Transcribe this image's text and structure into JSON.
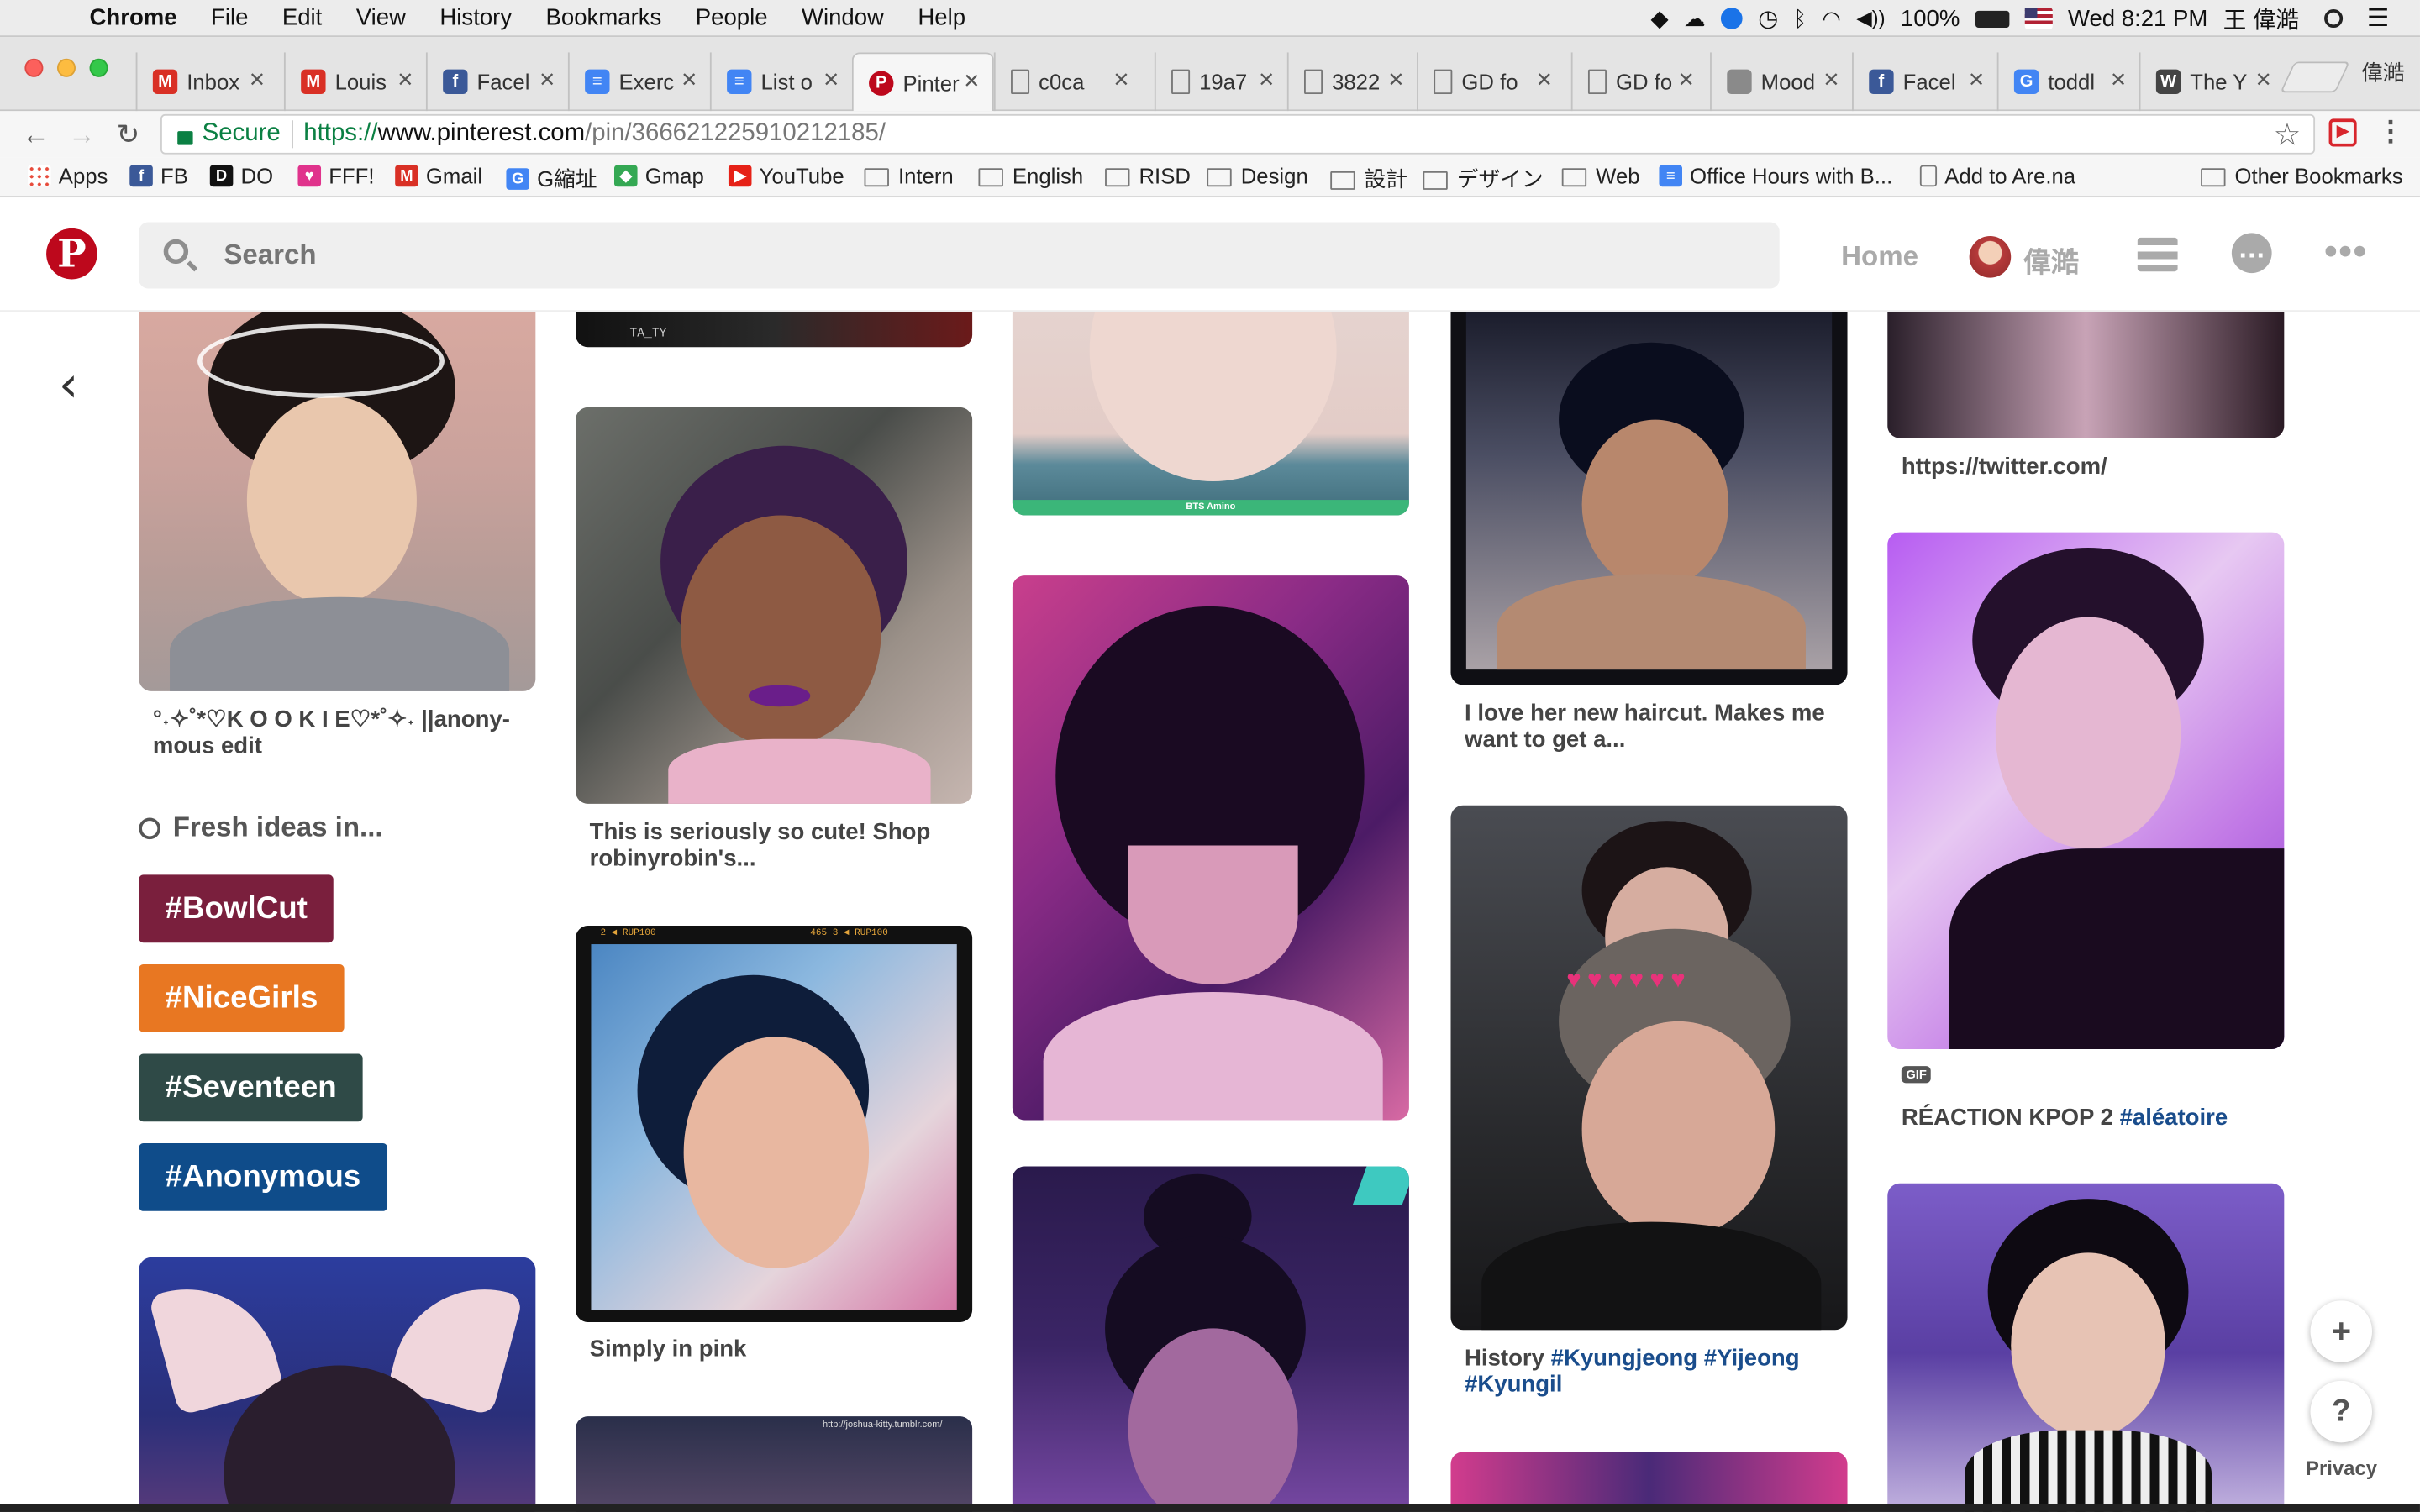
{
  "menubar": {
    "app": "Chrome",
    "items": [
      "File",
      "Edit",
      "View",
      "History",
      "Bookmarks",
      "People",
      "Window",
      "Help"
    ],
    "battery": "100%",
    "clock": "Wed 8:21 PM",
    "user": "王 偉澔"
  },
  "tabs": [
    {
      "label": "Inbox",
      "icon": "gmail-icon",
      "color": "#d93025",
      "glyph": "M"
    },
    {
      "label": "Louis",
      "icon": "gmail-icon",
      "color": "#d93025",
      "glyph": "M"
    },
    {
      "label": "Facel",
      "icon": "facebook-icon",
      "color": "#3b5998",
      "glyph": "f"
    },
    {
      "label": "Exerc",
      "icon": "docs-icon",
      "color": "#4285f4",
      "glyph": "≡"
    },
    {
      "label": "List o",
      "icon": "docs-icon",
      "color": "#4285f4",
      "glyph": "≡"
    },
    {
      "label": "Pinter",
      "icon": "pinterest-icon",
      "color": "#bd081c",
      "glyph": "P"
    },
    {
      "label": "c0ca",
      "icon": "file-icon",
      "color": "#999",
      "glyph": ""
    },
    {
      "label": "19a7",
      "icon": "file-icon",
      "color": "#999",
      "glyph": ""
    },
    {
      "label": "3822",
      "icon": "file-icon",
      "color": "#999",
      "glyph": ""
    },
    {
      "label": "GD fo",
      "icon": "file-icon",
      "color": "#999",
      "glyph": ""
    },
    {
      "label": "GD fo",
      "icon": "file-icon",
      "color": "#999",
      "glyph": ""
    },
    {
      "label": "Mood",
      "icon": "moodboard-icon",
      "color": "#8a8a8a",
      "glyph": ""
    },
    {
      "label": "Facel",
      "icon": "facebook-icon",
      "color": "#3b5998",
      "glyph": "f"
    },
    {
      "label": "toddl",
      "icon": "google-icon",
      "color": "#4285f4",
      "glyph": "G"
    },
    {
      "label": "The Y",
      "icon": "wikipedia-icon",
      "color": "#444",
      "glyph": "W"
    }
  ],
  "profile_name": "偉澔",
  "toolbar": {
    "secure": "Secure",
    "url_proto": "https://",
    "url_host": "www.pinterest.com",
    "url_path": "/pin/366621225910212185/"
  },
  "bookmarks": [
    {
      "label": "Apps",
      "icon": "apps-icon",
      "color": "#4a90d9",
      "glyph": ""
    },
    {
      "label": "FB",
      "icon": "facebook-icon",
      "color": "#3b5998",
      "glyph": "f"
    },
    {
      "label": "DO",
      "icon": "do-icon",
      "color": "#111",
      "glyph": "D"
    },
    {
      "label": "FFF!",
      "icon": "heart-icon",
      "color": "#e0338c",
      "glyph": "♥"
    },
    {
      "label": "Gmail",
      "icon": "gmail-icon",
      "color": "#d93025",
      "glyph": "M"
    },
    {
      "label": "G縮址",
      "icon": "google-icon",
      "color": "#4285f4",
      "glyph": "G"
    },
    {
      "label": "Gmap",
      "icon": "maps-icon",
      "color": "#34a853",
      "glyph": "◆"
    },
    {
      "label": "YouTube",
      "icon": "youtube-icon",
      "color": "#e62117",
      "glyph": "▶"
    },
    {
      "label": "Intern",
      "icon": "folder-icon",
      "color": "",
      "glyph": ""
    },
    {
      "label": "English",
      "icon": "folder-icon",
      "color": "",
      "glyph": ""
    },
    {
      "label": "RISD",
      "icon": "folder-icon",
      "color": "",
      "glyph": ""
    },
    {
      "label": "Design",
      "icon": "folder-icon",
      "color": "",
      "glyph": ""
    },
    {
      "label": "設計",
      "icon": "folder-icon",
      "color": "",
      "glyph": ""
    },
    {
      "label": "デザイン",
      "icon": "folder-icon",
      "color": "",
      "glyph": ""
    },
    {
      "label": "Web",
      "icon": "folder-icon",
      "color": "",
      "glyph": ""
    },
    {
      "label": "Office Hours with B...",
      "icon": "docs-icon",
      "color": "#4285f4",
      "glyph": "≡"
    },
    {
      "label": "Add to Are.na",
      "icon": "file-icon",
      "color": "",
      "glyph": ""
    },
    {
      "label": "Other Bookmarks",
      "icon": "folder-icon",
      "color": "",
      "glyph": ""
    }
  ],
  "header": {
    "search_placeholder": "Search",
    "home": "Home",
    "user": "偉澔"
  },
  "pins": {
    "col1_cap": "°˖✧˚*♡K O O K I E♡*˚✧˖ ||anony-mous edit",
    "fresh_ideas": "Fresh ideas in...",
    "hashtags": [
      {
        "label": "#BowlCut",
        "color": "#7a1f3d"
      },
      {
        "label": "#NiceGirls",
        "color": "#e87722"
      },
      {
        "label": "#Seventeen",
        "color": "#2f4a47"
      },
      {
        "label": "#Anonymous",
        "color": "#0f4c8a"
      }
    ],
    "col2_cap1": "This is seriously so cute! Shop robinyrobin's...",
    "col2_cap2": "Simply in pink",
    "col3_strip": "BTS Amino",
    "col4_cap1": "I love her new haircut. Makes me want to get a...",
    "col4_cap2_text": "History",
    "col4_cap2_tags": "#Kyungjeong #Yijeong #Kyungil",
    "col5_cap1": "https://twitter.com/",
    "col5_gif": "GIF",
    "col5_cap2_text": "RÉACTION KPOP 2",
    "col5_cap2_tag": "#aléatoire",
    "film1": "2 ◄ RUP100",
    "film2": "465   3 ◄ RUP100",
    "watermark": "TA_TY",
    "watermark2": "http://joshua-kitty.tumblr.com/"
  },
  "floating": {
    "plus": "+",
    "help": "?",
    "privacy": "Privacy"
  }
}
